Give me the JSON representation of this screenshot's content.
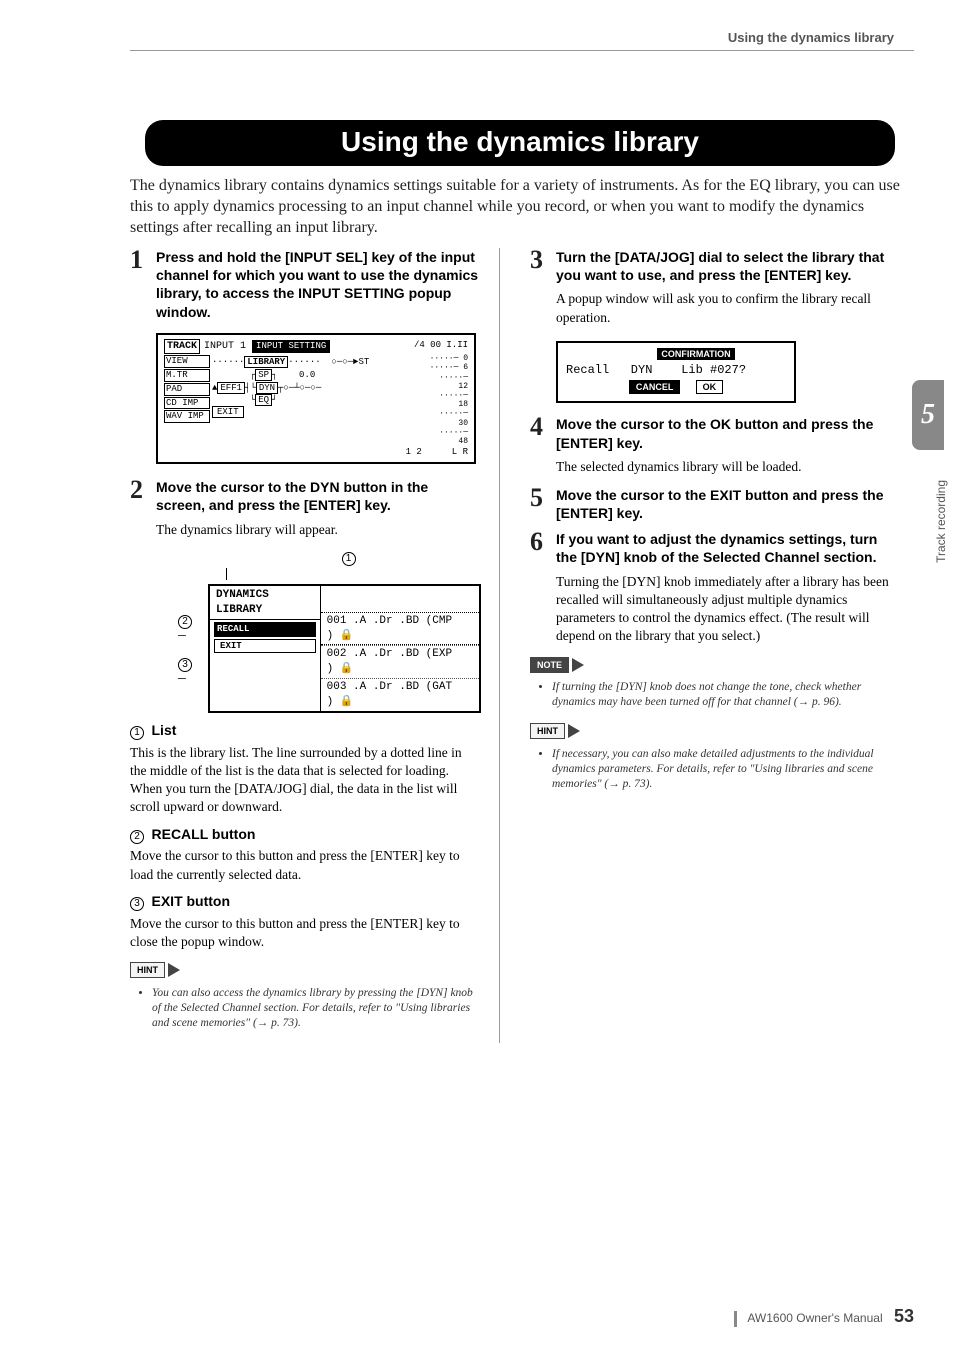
{
  "header": {
    "running": "Using the dynamics library"
  },
  "title": "Using the dynamics library",
  "intro": "The dynamics library contains dynamics settings suitable for a variety of instruments. As for the EQ library, you can use this to apply dynamics processing to an input channel while you record, or when you want to modify the dynamics settings after recalling an input library.",
  "chapter": {
    "num": "5",
    "label": "Track recording"
  },
  "left": {
    "step1": {
      "num": "1",
      "head": "Press and hold the [INPUT SEL] key of the input channel for which you want to use the dynamics library, to access the INPUT SETTING popup window."
    },
    "screenshot1": {
      "col_track": "TRACK",
      "col_view": "VIEW",
      "col_mtr": "M.TR",
      "col_pad": "PAD",
      "col_cd": "CD  IMP",
      "col_wav": "WAV IMP",
      "input_label": "INPUT",
      "input_num": "1",
      "win_title": "INPUT SETTING",
      "library_btn": "LIBRARY",
      "sp_btn": "SP",
      "eff_btn": "EFF1",
      "dyn_btn": "DYN",
      "eq_btn": "EQ",
      "val": "0.0",
      "st": "ST",
      "exit_btn": "EXIT",
      "meter_top": "/4 00 I.II",
      "m0": "0",
      "m6": "6",
      "m12": "12",
      "m18": "18",
      "m30": "30",
      "m48": "48",
      "bot_l": "1 2",
      "bot_r": "L R"
    },
    "step2": {
      "num": "2",
      "head": "Move the cursor to the DYN button in the screen, and press the [ENTER] key.",
      "body": "The dynamics library will appear."
    },
    "markers": {
      "m1": "1",
      "m2": "2",
      "m3": "3"
    },
    "screenshot2": {
      "title": "DYNAMICS LIBRARY",
      "recall": "RECALL",
      "exit": "EXIT",
      "row1": "001 .A .Dr .BD (CMP )",
      "row2": "002 .A .Dr .BD (EXP )",
      "row3": "003 .A .Dr .BD (GAT )",
      "lock": "🔒"
    },
    "labels": {
      "l1_title": "List",
      "l1_text": "This is the library list. The line surrounded by a dotted line in the middle of the list is the data that is selected for loading. When you turn the [DATA/JOG] dial, the data in the list will scroll upward or downward.",
      "l2_title": "RECALL button",
      "l2_text": "Move the cursor to this button and press the [ENTER] key to load the currently selected data.",
      "l3_title": "EXIT button",
      "l3_text": "Move the cursor to this button and press the [ENTER] key to close the popup window."
    },
    "hint": {
      "tag": "HINT",
      "text": "You can also access the dynamics library by pressing the [DYN] knob of the Selected Channel section. For details, refer to \"Using libraries and scene memories\" (→ p. 73)."
    }
  },
  "right": {
    "step3": {
      "num": "3",
      "head": "Turn the [DATA/JOG] dial to select the library that you want to use, and press the [ENTER] key.",
      "body": "A popup window will ask you to confirm the library recall operation."
    },
    "confirm": {
      "title": "CONFIRMATION",
      "line": "Recall   DYN    Lib #027?",
      "cancel": "CANCEL",
      "ok": "OK"
    },
    "step4": {
      "num": "4",
      "head": "Move the cursor to the OK button and press the [ENTER] key.",
      "body": "The selected dynamics library will be loaded."
    },
    "step5": {
      "num": "5",
      "head": "Move the cursor to the EXIT button and press the [ENTER] key."
    },
    "step6": {
      "num": "6",
      "head": "If you want to adjust the dynamics settings, turn the [DYN] knob of the Selected Channel section.",
      "body": "Turning the [DYN] knob immediately after a library has been recalled will simultaneously adjust multiple dynamics parameters to control the dynamics effect. (The result will depend on the library that you select.)"
    },
    "note": {
      "tag": "NOTE",
      "text": "If turning the [DYN] knob does not change the tone, check whether dynamics may have been turned off for that channel (→ p. 96)."
    },
    "hint": {
      "tag": "HINT",
      "text": "If necessary, you can also make detailed adjustments to the individual dynamics parameters. For details, refer to \"Using libraries and scene memories\" (→ p. 73)."
    }
  },
  "footer": {
    "manual": "AW1600 Owner's Manual",
    "page": "53"
  }
}
